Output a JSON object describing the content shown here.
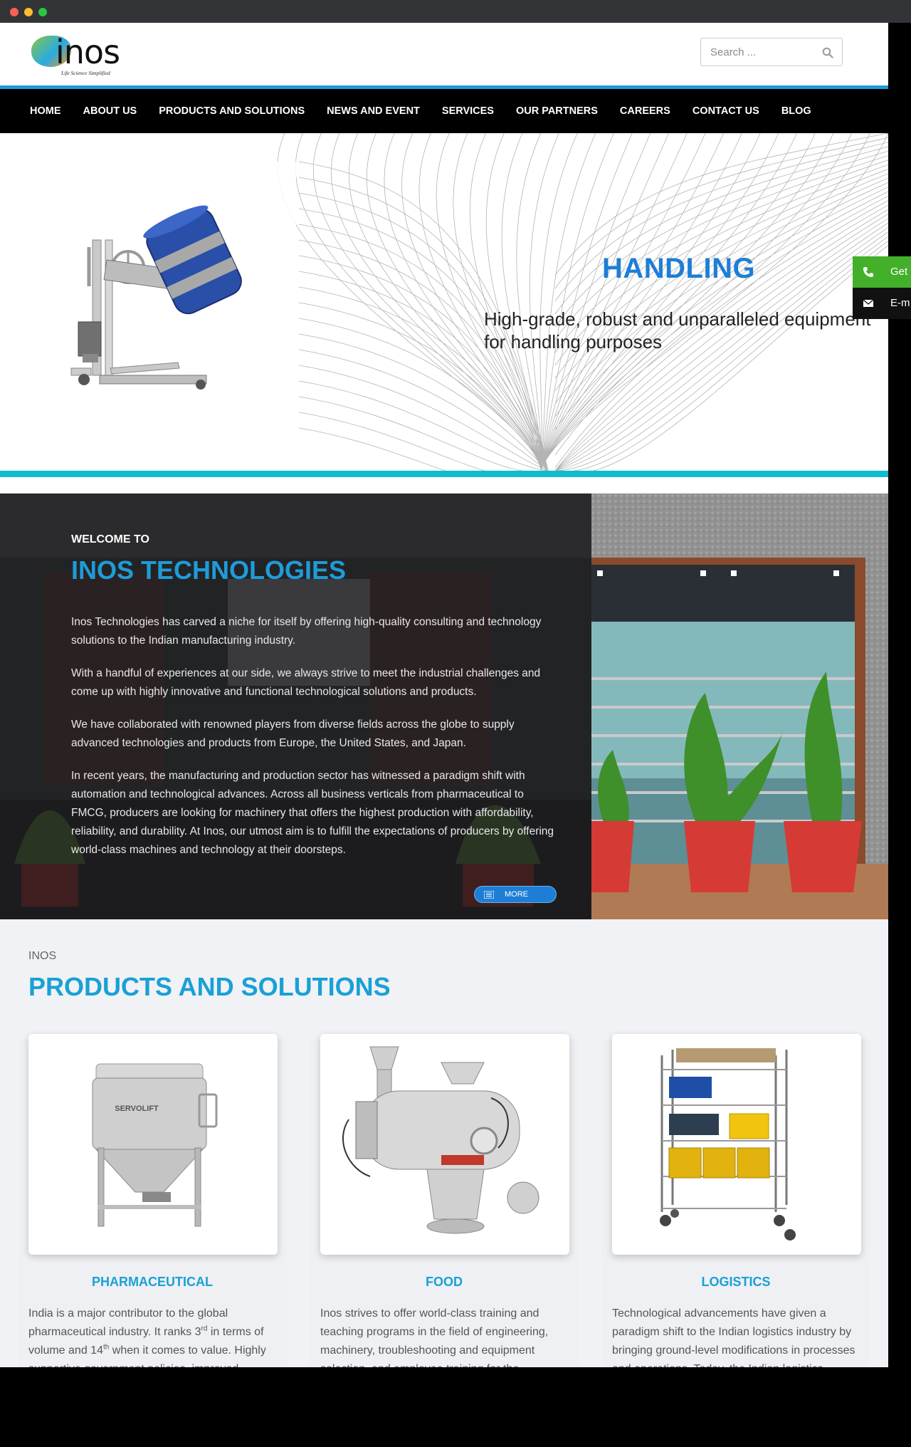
{
  "brand": {
    "name": "inos",
    "tagline": "Life Science Simplified",
    "accent": "#1f9bd8",
    "cyan": "#0fbcd0",
    "green": "#43b02a"
  },
  "search": {
    "placeholder": "Search ...",
    "icon": "magnifier-icon"
  },
  "nav": {
    "items": [
      "HOME",
      "ABOUT US",
      "PRODUCTS AND SOLUTIONS",
      "NEWS AND EVENT",
      "SERVICES",
      "OUR PARTNERS",
      "CAREERS",
      "CONTACT US",
      "BLOG"
    ]
  },
  "hero": {
    "title": "HANDLING",
    "subtitle": "High-grade, robust and unparalleled equipment for handling purposes",
    "image": "drum-lifter-illustration"
  },
  "floating": {
    "call_label": "Get",
    "mail_label": "E-m",
    "call_icon": "phone-icon",
    "mail_icon": "envelope-icon"
  },
  "welcome": {
    "kicker": "WELCOME TO",
    "title": "INOS TECHNOLOGIES",
    "paragraphs": [
      "Inos Technologies has carved a niche for itself by offering high-quality consulting and technology solutions to the Indian manufacturing industry.",
      "With a handful of experiences at our side, we always strive to meet the industrial challenges and come up with highly innovative and functional technological solutions and products.",
      "We have collaborated with renowned players from diverse fields across the globe to supply advanced technologies and products from Europe, the United States, and Japan.",
      "In recent years, the manufacturing and production sector has witnessed a paradigm shift with automation and technological advances. Across all business verticals from pharmaceutical to FMCG, producers are looking for machinery that offers the highest production with affordability, reliability, and durability. At Inos, our utmost aim is to fulfill the expectations of producers by offering world-class machines and technology at their doorsteps."
    ],
    "more_label": "MORE",
    "more_icon": "list-icon"
  },
  "products": {
    "kicker": "INOS",
    "title": "PRODUCTS AND SOLUTIONS",
    "cards": [
      {
        "title": "PHARMACEUTICAL",
        "image": "ibc-container-illustration",
        "image_label": "SERVOLIFT",
        "text_a": "India is a major contributor to the global pharmaceutical industry. It ranks 3",
        "sup_a": "rd",
        "text_b": " in terms of volume and 14",
        "sup_b": "th",
        "text_c": " when it comes to value. Highly supportive government policies, improved"
      },
      {
        "title": "FOOD",
        "image": "mixer-machine-illustration",
        "image_label": "",
        "text_a": "Inos strives to offer world-class training and teaching programs in the field of engineering, machinery, troubleshooting and equipment selection, and employee training for the",
        "sup_a": "",
        "text_b": "",
        "sup_b": "",
        "text_c": ""
      },
      {
        "title": "LOGISTICS",
        "image": "wire-cart-illustration",
        "image_label": "",
        "text_a": "Technological advancements have given a paradigm shift to the Indian logistics industry by bringing ground-level modifications in processes and operations. Today, the Indian logistics",
        "sup_a": "",
        "text_b": "",
        "sup_b": "",
        "text_c": ""
      }
    ]
  }
}
